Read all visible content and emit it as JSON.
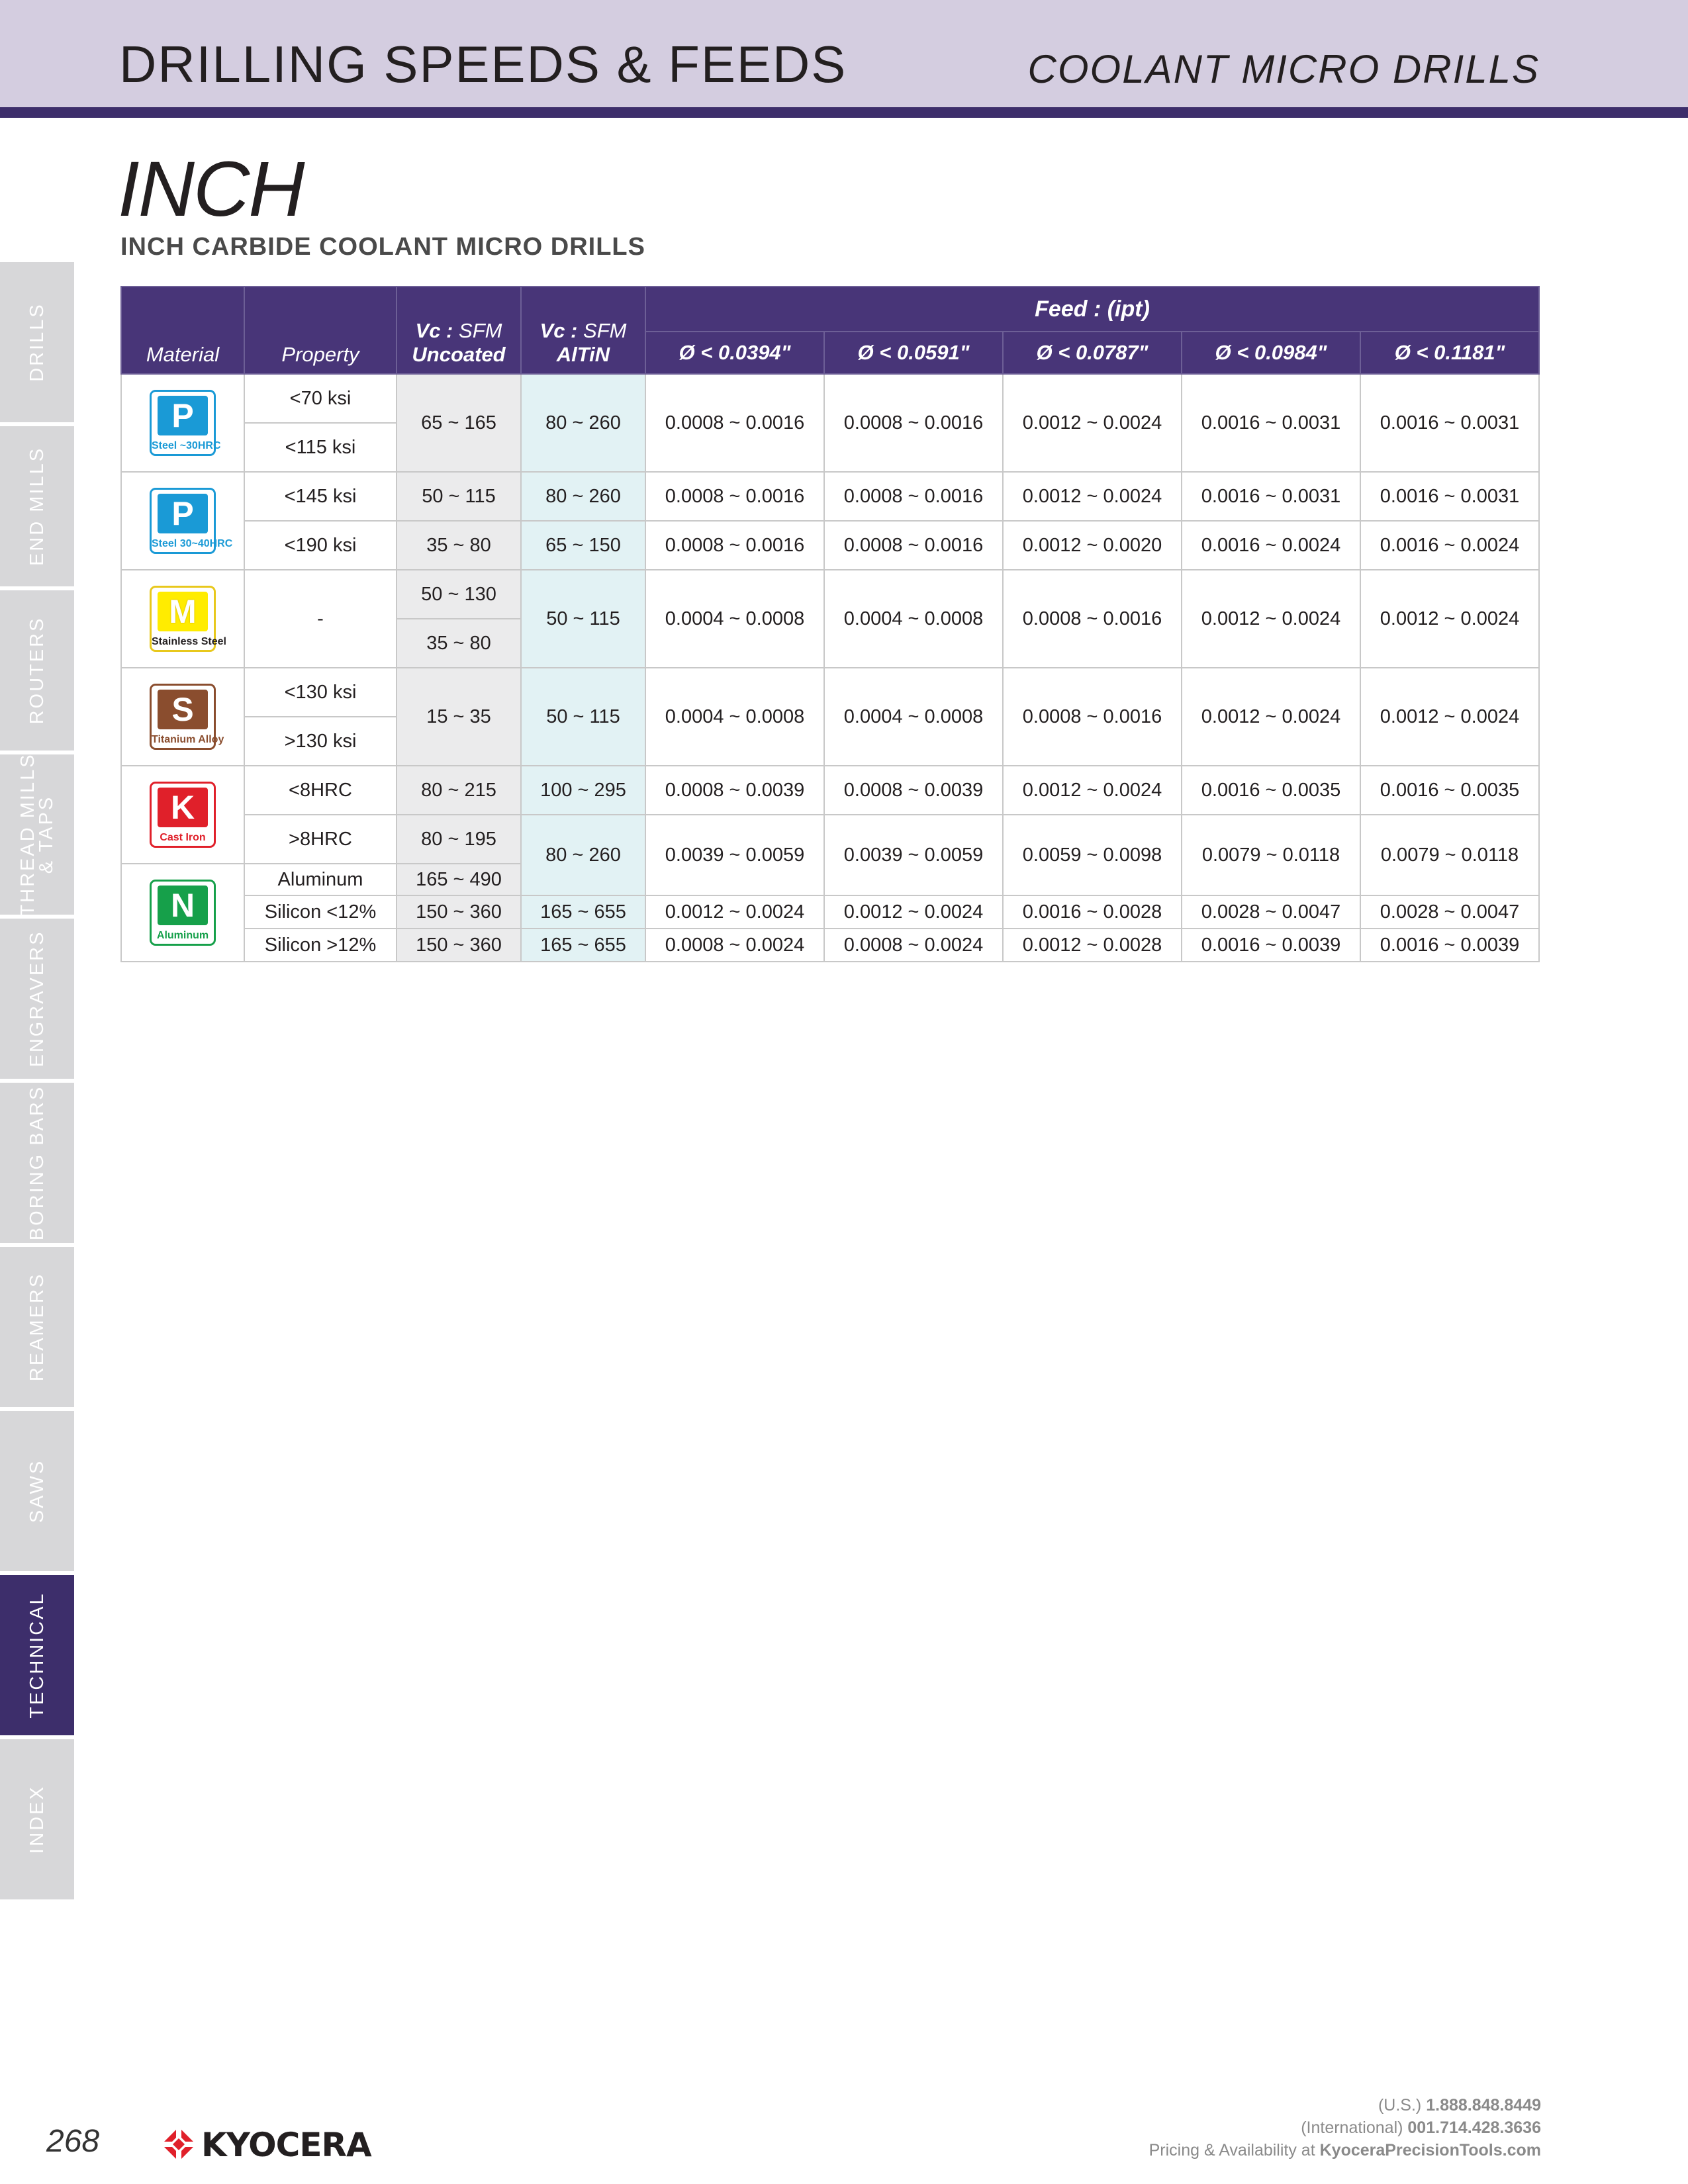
{
  "header": {
    "title": "DRILLING SPEEDS & FEEDS",
    "subtitle": "COOLANT MICRO DRILLS"
  },
  "section": {
    "title": "INCH",
    "subtitle": "INCH CARBIDE COOLANT MICRO DRILLS"
  },
  "side_tabs": [
    {
      "label": "DRILLS",
      "active": false
    },
    {
      "label": "END MILLS",
      "active": false
    },
    {
      "label": "ROUTERS",
      "active": false
    },
    {
      "label": "THREAD MILLS",
      "label2": "& TAPS",
      "active": false
    },
    {
      "label": "ENGRAVERS",
      "active": false
    },
    {
      "label": "BORING BARS",
      "active": false
    },
    {
      "label": "REAMERS",
      "active": false
    },
    {
      "label": "SAWS",
      "active": false
    },
    {
      "label": "TECHNICAL",
      "active": true
    },
    {
      "label": "INDEX",
      "active": false
    }
  ],
  "table": {
    "headers": {
      "material": "Material",
      "property": "Property",
      "vc_prefix": "Vc :",
      "vc_unit": "SFM",
      "uncoated": "Uncoated",
      "altin": "AlTiN",
      "feed_title": "Feed : (ipt)",
      "diameters": [
        "Ø < 0.0394\"",
        "Ø < 0.0591\"",
        "Ø < 0.0787\"",
        "Ø < 0.0984\"",
        "Ø < 0.1181\""
      ]
    },
    "materials": {
      "p1": {
        "letter": "P",
        "caption": "Steel ~30HRC",
        "color": "#1a9ad6"
      },
      "p2": {
        "letter": "P",
        "caption": "Steel 30~40HRC",
        "color": "#1a9ad6"
      },
      "m": {
        "letter": "M",
        "caption": "Stainless Steel",
        "color": "#ffec00"
      },
      "s": {
        "letter": "S",
        "caption": "Titanium Alloy",
        "color": "#8a4d2e"
      },
      "k": {
        "letter": "K",
        "caption": "Cast Iron",
        "color": "#e0202a"
      },
      "n": {
        "letter": "N",
        "caption": "Aluminum",
        "color": "#16a04a"
      }
    },
    "rows": {
      "p1": {
        "properties": [
          "<70 ksi",
          "<115 ksi"
        ],
        "uncoated": "65 ~ 165",
        "altin": "80 ~ 260",
        "feeds": [
          "0.0008 ~ 0.0016",
          "0.0008 ~ 0.0016",
          "0.0012 ~ 0.0024",
          "0.0016 ~ 0.0031",
          "0.0016 ~ 0.0031"
        ]
      },
      "p2a": {
        "property": "<145 ksi",
        "uncoated": "50 ~ 115",
        "altin": "80 ~ 260",
        "feeds": [
          "0.0008 ~ 0.0016",
          "0.0008 ~ 0.0016",
          "0.0012 ~ 0.0024",
          "0.0016 ~ 0.0031",
          "0.0016 ~ 0.0031"
        ]
      },
      "p2b": {
        "property": "<190 ksi",
        "uncoated": "35 ~ 80",
        "altin": "65 ~ 150",
        "feeds": [
          "0.0008 ~ 0.0016",
          "0.0008 ~ 0.0016",
          "0.0012 ~ 0.0020",
          "0.0016 ~ 0.0024",
          "0.0016 ~ 0.0024"
        ]
      },
      "m": {
        "property": "-",
        "uncoated": [
          "50 ~ 130",
          "35 ~ 80"
        ],
        "altin": "50 ~ 115",
        "feeds": [
          "0.0004 ~ 0.0008",
          "0.0004 ~ 0.0008",
          "0.0008 ~ 0.0016",
          "0.0012 ~ 0.0024",
          "0.0012 ~ 0.0024"
        ]
      },
      "s": {
        "properties": [
          "<130 ksi",
          ">130 ksi"
        ],
        "uncoated": "15 ~ 35",
        "altin": "50 ~ 115",
        "feeds": [
          "0.0004 ~ 0.0008",
          "0.0004 ~ 0.0008",
          "0.0008 ~ 0.0016",
          "0.0012 ~ 0.0024",
          "0.0012 ~ 0.0024"
        ]
      },
      "k1": {
        "property": "<8HRC",
        "uncoated": "80 ~ 215",
        "altin": "100 ~ 295",
        "feeds": [
          "0.0008 ~ 0.0039",
          "0.0008 ~ 0.0039",
          "0.0012 ~ 0.0024",
          "0.0016 ~ 0.0035",
          "0.0016 ~ 0.0035"
        ]
      },
      "k2": {
        "property": ">8HRC",
        "uncoated": "80 ~ 195",
        "altin": "80 ~ 260",
        "feeds": [
          "0.0039 ~ 0.0059",
          "0.0039 ~ 0.0059",
          "0.0059 ~ 0.0098",
          "0.0079 ~ 0.0118",
          "0.0079 ~ 0.0118"
        ]
      },
      "n1": {
        "property": "Aluminum",
        "uncoated": "165 ~ 490"
      },
      "n2": {
        "property": "Silicon <12%",
        "uncoated": "150 ~ 360",
        "altin": "165 ~ 655",
        "feeds": [
          "0.0012 ~ 0.0024",
          "0.0012 ~ 0.0024",
          "0.0016 ~ 0.0028",
          "0.0028 ~ 0.0047",
          "0.0028 ~ 0.0047"
        ]
      },
      "n3": {
        "property": "Silicon >12%",
        "uncoated": "150 ~ 360",
        "altin": "165 ~ 655",
        "feeds": [
          "0.0008 ~ 0.0024",
          "0.0008 ~ 0.0024",
          "0.0012 ~ 0.0028",
          "0.0016 ~ 0.0039",
          "0.0016 ~ 0.0039"
        ]
      }
    }
  },
  "footer": {
    "page_number": "268",
    "brand": "KYOCERA",
    "us_label": "(U.S.)",
    "us_phone": "1.888.848.8449",
    "intl_label": "(International)",
    "intl_phone": "001.714.428.3636",
    "pricing_text": "Pricing & Availability at",
    "website": "KyoceraPrecisionTools.com"
  }
}
